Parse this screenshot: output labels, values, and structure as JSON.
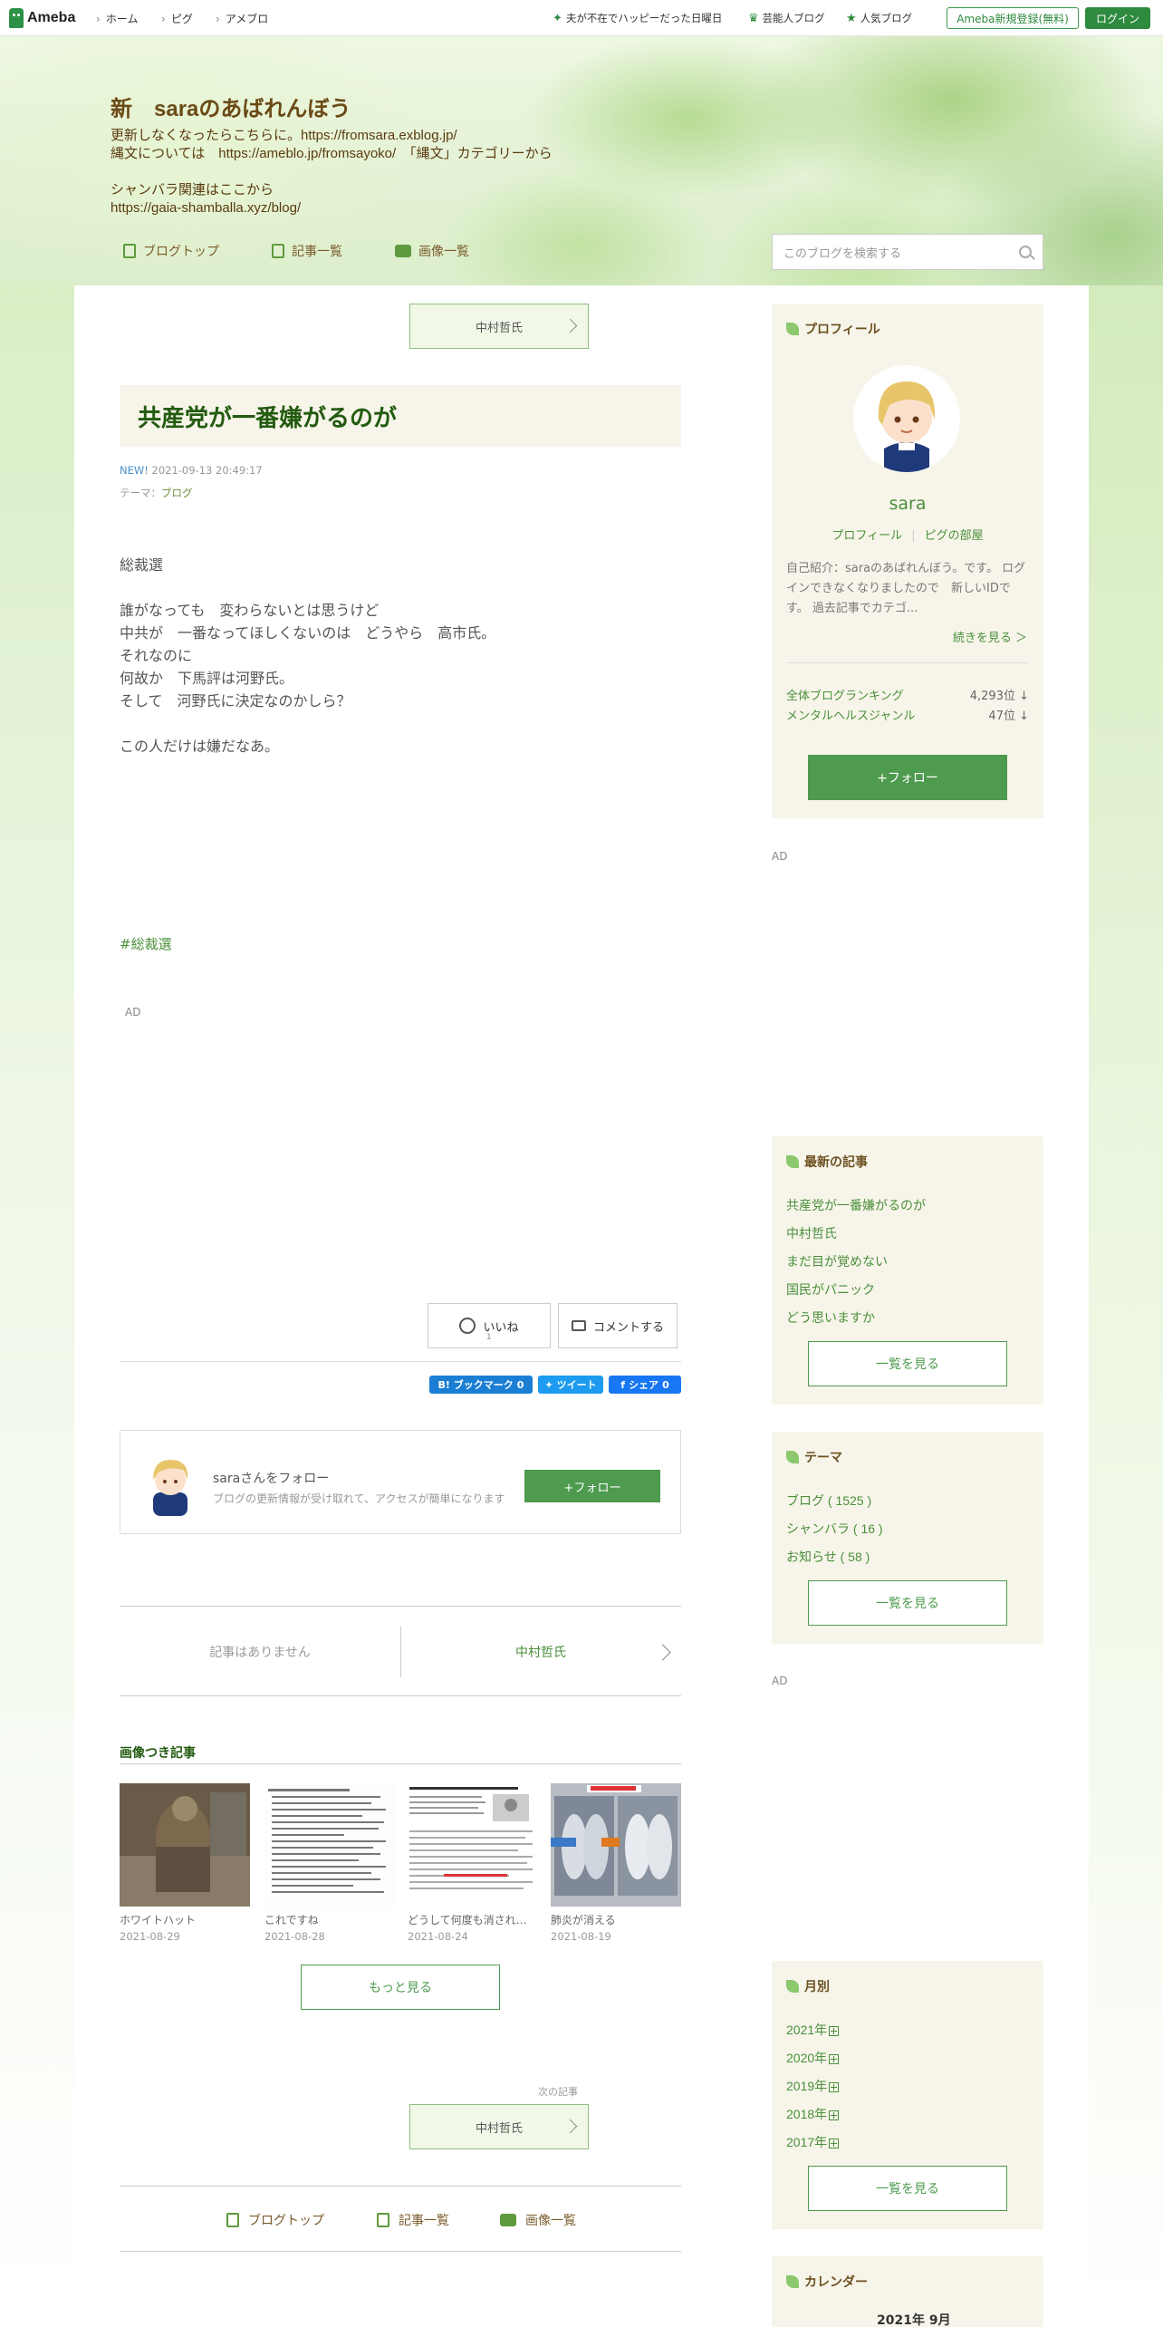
{
  "header": {
    "logo_text": "Ameba",
    "nav": [
      "ホーム",
      "ピグ",
      "アメブロ"
    ],
    "links": [
      {
        "icon": "sparkle-icon",
        "label": "夫が不在でハッピーだった日曜日"
      },
      {
        "icon": "crown-icon",
        "label": "芸能人ブログ"
      },
      {
        "icon": "star-icon",
        "label": "人気ブログ"
      }
    ],
    "register_label": "Ameba新規登録(無料)",
    "login_label": "ログイン"
  },
  "banner": {
    "title": "新　saraのあばれんぼう",
    "description": "更新しなくなったらこちらに。https://fromsara.exblog.jp/\n縄文については　https://ameblo.jp/fromsayoko/　「縄文」カテゴリーから\n\nシャンバラ関連はここから\nhttps://gaia-shamballa.xyz/blog/",
    "nav": [
      "ブログトップ",
      "記事一覧",
      "画像一覧"
    ],
    "search_placeholder": "このブログを検索する"
  },
  "entry": {
    "prev_nav_label": "中村哲氏",
    "title": "共産党が一番嫌がるのが",
    "new_label": "NEW!",
    "datetime": "2021-09-13 20:49:17",
    "theme_prefix": "テーマ：",
    "theme": "ブログ",
    "body": "総裁選\n\n誰がなっても　変わらないとは思うけど\n中共が　一番なってほしくないのは　どうやら　高市氏。\nそれなのに\n何故か　下馬評は河野氏。\nそして　河野氏に決定なのかしら？\n\nこの人だけは嫌だなあ。",
    "hashtag": "#総裁選",
    "ad_label": "AD",
    "like_label": "いいね",
    "like_count": "1",
    "comment_label": "コメントする",
    "share": {
      "hatena": "B! ブックマーク",
      "hatena_count": "0",
      "tweet": "ツイート",
      "facebook": "シェア",
      "facebook_count": "0"
    }
  },
  "follow_box": {
    "name": "saraさんをフォロー",
    "sub": "ブログの更新情報が受け取れて、アクセスが簡単になります",
    "button": "+フォロー"
  },
  "pager": {
    "prev": "記事はありません",
    "next": "中村哲氏"
  },
  "photo_entries": {
    "heading": "画像つき記事",
    "items": [
      {
        "caption": "ホワイトハット",
        "date": "2021-08-29"
      },
      {
        "caption": "これですね",
        "date": "2021-08-28"
      },
      {
        "caption": "どうして何度も消され…",
        "date": "2021-08-24"
      },
      {
        "caption": "肺炎が消える",
        "date": "2021-08-19"
      }
    ],
    "more_label": "もっと見る"
  },
  "next_entry": {
    "label": "次の記事",
    "title": "中村哲氏"
  },
  "bottom_nav": [
    "ブログトップ",
    "記事一覧",
    "画像一覧"
  ],
  "sidebar": {
    "profile": {
      "heading": "プロフィール",
      "name": "sara",
      "link1": "プロフィール",
      "link2": "ピグの部屋",
      "description": "自己紹介：saraのあばれんぼう。です。 ログインできなくなりましたので　新しいIDです。 過去記事でカテゴ...",
      "more": "続きを見る ＞",
      "ranks": [
        {
          "label": "全体ブログランキング",
          "value": "4,293位 ↓"
        },
        {
          "label": "メンタルヘルスジャンル",
          "value": "47位 ↓"
        }
      ],
      "follow": "+フォロー"
    },
    "ad_label": "AD",
    "recent": {
      "heading": "最新の記事",
      "items": [
        "共産党が一番嫌がるのが",
        "中村哲氏",
        "まだ目が覚めない",
        "国民がパニック",
        "どう思いますか"
      ],
      "all_label": "一覧を見る"
    },
    "theme": {
      "heading": "テーマ",
      "items": [
        "ブログ ( 1525 )",
        "シャンバラ ( 16 )",
        "お知らせ ( 58 )"
      ],
      "all_label": "一覧を見る"
    },
    "ad_label2": "AD",
    "monthly": {
      "heading": "月別",
      "items": [
        "2021年",
        "2020年",
        "2019年",
        "2018年",
        "2017年"
      ],
      "all_label": "一覧を見る"
    },
    "calendar": {
      "heading": "カレンダー",
      "month": "2021年 9月"
    }
  },
  "colors": {
    "brand_green": "#2d8a3e",
    "link_green": "#4a8f3a",
    "title_green": "#235b10",
    "sidebar_bg": "#f7f5ea"
  }
}
